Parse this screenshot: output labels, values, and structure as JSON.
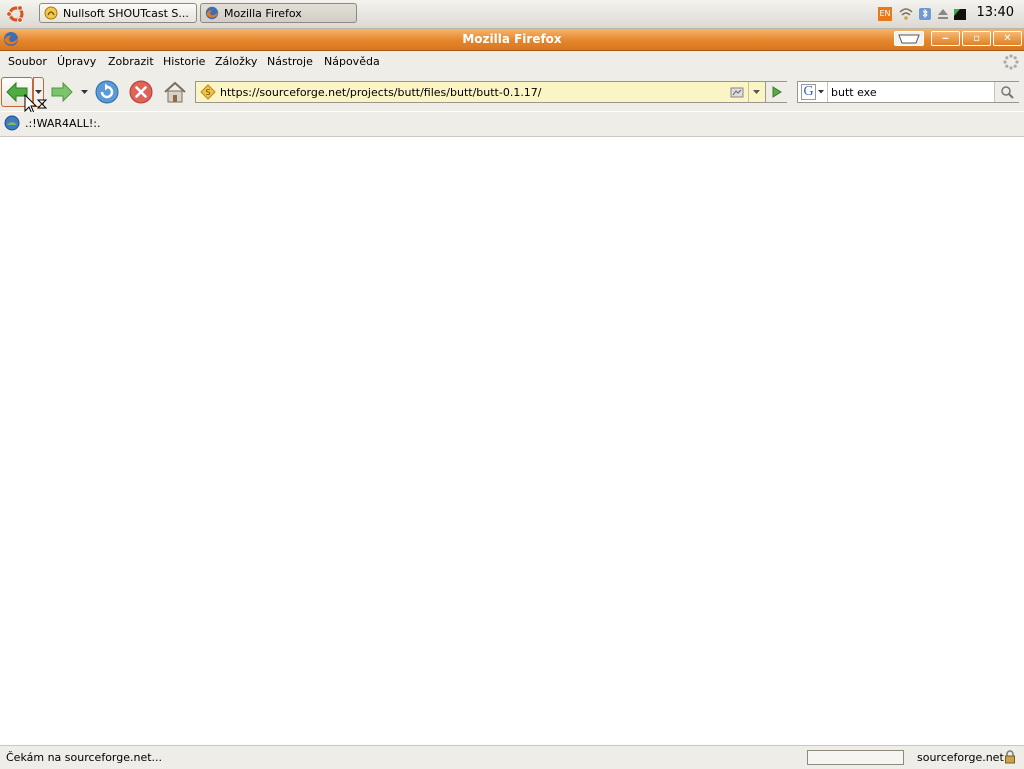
{
  "taskbar": {
    "tasks": [
      {
        "label": "Nullsoft SHOUTcast S...",
        "icon": "shoutcast-icon"
      },
      {
        "label": "Mozilla Firefox",
        "icon": "firefox-icon"
      }
    ],
    "tray": {
      "keyboard_layout": "EN"
    },
    "clock": "13:40"
  },
  "window": {
    "title": "Mozilla Firefox"
  },
  "menubar": {
    "items": [
      {
        "label": "Soubor"
      },
      {
        "label": "Úpravy"
      },
      {
        "label": "Zobrazit"
      },
      {
        "label": "Historie"
      },
      {
        "label": "Záložky"
      },
      {
        "label": "Nástroje"
      },
      {
        "label": "Nápověda"
      }
    ]
  },
  "navbar": {
    "url": "https://sourceforge.net/projects/butt/files/butt/butt-0.1.17/",
    "search_engine": "G",
    "search_value": "butt exe"
  },
  "bookmarks": {
    "items": [
      {
        "label": ".:!WAR4ALL!:."
      }
    ]
  },
  "status": {
    "text": "Čekám na sourceforge.net...",
    "host": "sourceforge.net"
  },
  "colors": {
    "titlebar": "#e5862c",
    "urlbar_bg": "#fbf5c5",
    "chrome_bg": "#efede8"
  }
}
